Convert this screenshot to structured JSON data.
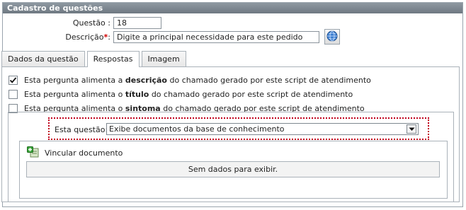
{
  "panel": {
    "title": "Cadastro de questões"
  },
  "form": {
    "questao_label": "Questão :",
    "questao_value": "18",
    "descricao_label": "Descrição",
    "descricao_required": "*",
    "descricao_colon": ":",
    "descricao_value": "Digite a principal necessidade para este pedido"
  },
  "tabs": [
    {
      "label": "Dados da questão",
      "active": false
    },
    {
      "label": "Respostas",
      "active": true
    },
    {
      "label": "Imagem",
      "active": false
    }
  ],
  "checkboxes": [
    {
      "pre": "Esta pergunta alimenta a ",
      "bold": "descrição",
      "post": " do chamado gerado por este script de atendimento",
      "checked": true
    },
    {
      "pre": "Esta pergunta alimenta o ",
      "bold": "título",
      "post": " do chamado gerado por este script de atendimento",
      "checked": false
    },
    {
      "pre": "Esta pergunta alimenta o ",
      "bold": "sintoma",
      "post": " do chamado gerado por este script de atendimento",
      "checked": false
    }
  ],
  "selector": {
    "label": "Esta questão:",
    "value": "Exibe documentos da base de conhecimento"
  },
  "documents": {
    "link_label": "Vincular documento",
    "empty_text": "Sem dados para exibir."
  },
  "colors": {
    "header": "#7f8992",
    "required": "#d00000",
    "highlight_border": "#c0001b"
  }
}
